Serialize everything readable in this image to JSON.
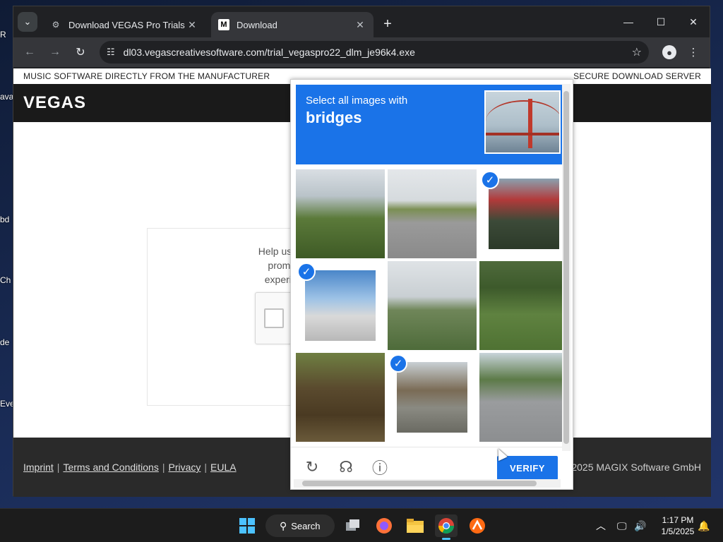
{
  "desktop": {
    "labels": [
      "R",
      "ava",
      "bd",
      "Ch",
      "de",
      "Eve"
    ]
  },
  "browser": {
    "tabs": [
      {
        "title": "Download VEGAS Pro Trials for",
        "icon": "settings-icon",
        "active": false
      },
      {
        "title": "Download",
        "icon": "m-logo-icon",
        "active": true
      }
    ],
    "new_tab": "+",
    "url": "dl03.vegascreativesoftware.com/trial_vegaspro22_dlm_je96k4.exe"
  },
  "page": {
    "top_left": "MUSIC SOFTWARE DIRECTLY FROM THE MANUFACTURER",
    "top_right": "SECURE DOWNLOAD SERVER",
    "logo": "VEGAS",
    "verify_text_line1": "Help us preve",
    "verify_text_line2": "prompted",
    "verify_text_line3": "experiencir",
    "footer_links": [
      "Imprint",
      "Terms and Conditions",
      "Privacy",
      "EULA"
    ],
    "copyright": "2025 MAGIX Software GmbH"
  },
  "challenge": {
    "prompt": "Select all images with",
    "target": "bridges",
    "verify_label": "VERIFY",
    "tiles": [
      {
        "name": "power-lines",
        "selected": false
      },
      {
        "name": "overpass-road",
        "selected": false
      },
      {
        "name": "lifeguard-tower",
        "selected": true
      },
      {
        "name": "curved-bridge",
        "selected": true
      },
      {
        "name": "bridge-trees",
        "selected": false
      },
      {
        "name": "grass-field",
        "selected": false
      },
      {
        "name": "bushes",
        "selected": false
      },
      {
        "name": "railway-bridge",
        "selected": true
      },
      {
        "name": "highway-cars",
        "selected": false
      }
    ]
  },
  "taskbar": {
    "search_label": "Search",
    "time": "1:17 PM",
    "date": "1/5/2025"
  },
  "colors": {
    "accent": "#1a73e8",
    "header_bg": "#1a1a1a",
    "footer_bg": "#2a2a2a",
    "chrome_bg": "#202124"
  }
}
